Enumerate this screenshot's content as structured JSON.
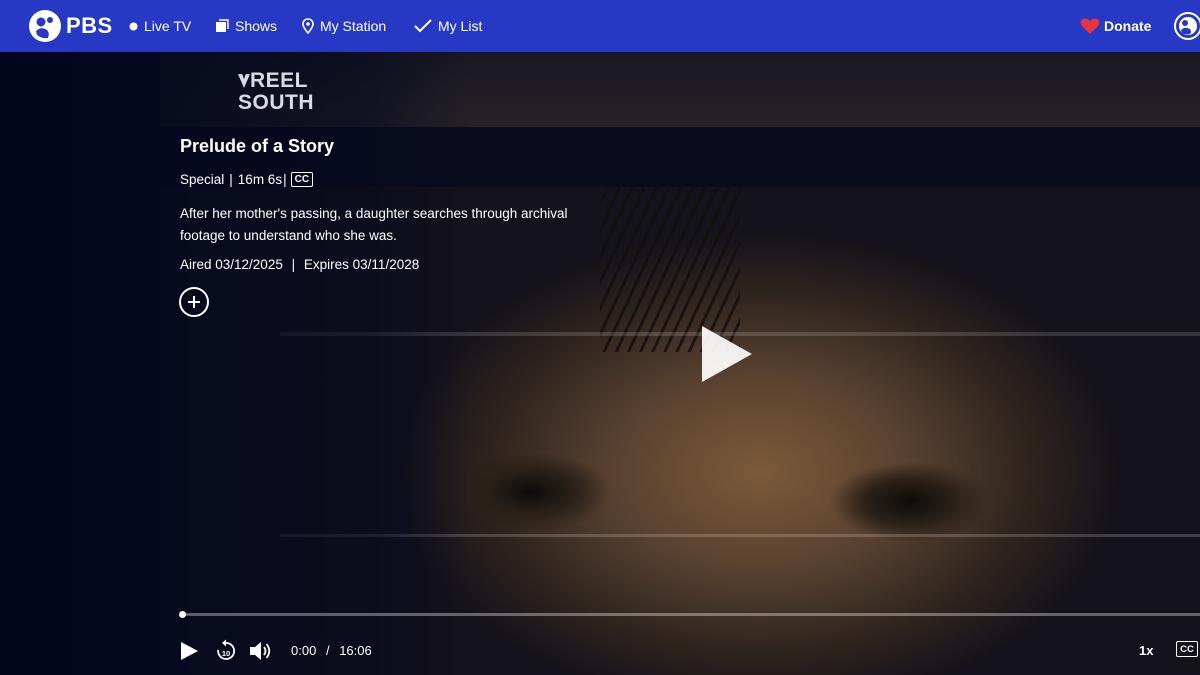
{
  "nav": {
    "brand": "PBS",
    "items": [
      {
        "label": "Live TV",
        "icon": "live-dot-icon"
      },
      {
        "label": "Shows",
        "icon": "shows-icon"
      },
      {
        "label": "My Station",
        "icon": "location-pin-icon"
      },
      {
        "label": "My List",
        "icon": "checkmark-icon"
      }
    ],
    "donate_label": "Donate"
  },
  "show": {
    "logo_line1": "REEL",
    "logo_line2": "SOUTH"
  },
  "episode": {
    "title": "Prelude of a Story",
    "type": "Special",
    "sep": "|",
    "duration": "16m 6s",
    "cc_badge": "CC",
    "description": "After her mother's passing, a daughter searches through archival footage to understand who she was.",
    "aired": "Aired 03/12/2025",
    "expires": "Expires 03/11/2028"
  },
  "player": {
    "current_time": "0:00",
    "time_sep": "/",
    "total_time": "16:06",
    "progress": 0,
    "speed": "1x",
    "cc_label": "CC"
  },
  "colors": {
    "nav_bg": "#2638c4",
    "donate_heart": "#e8343a",
    "page_bg": "#07091f"
  }
}
